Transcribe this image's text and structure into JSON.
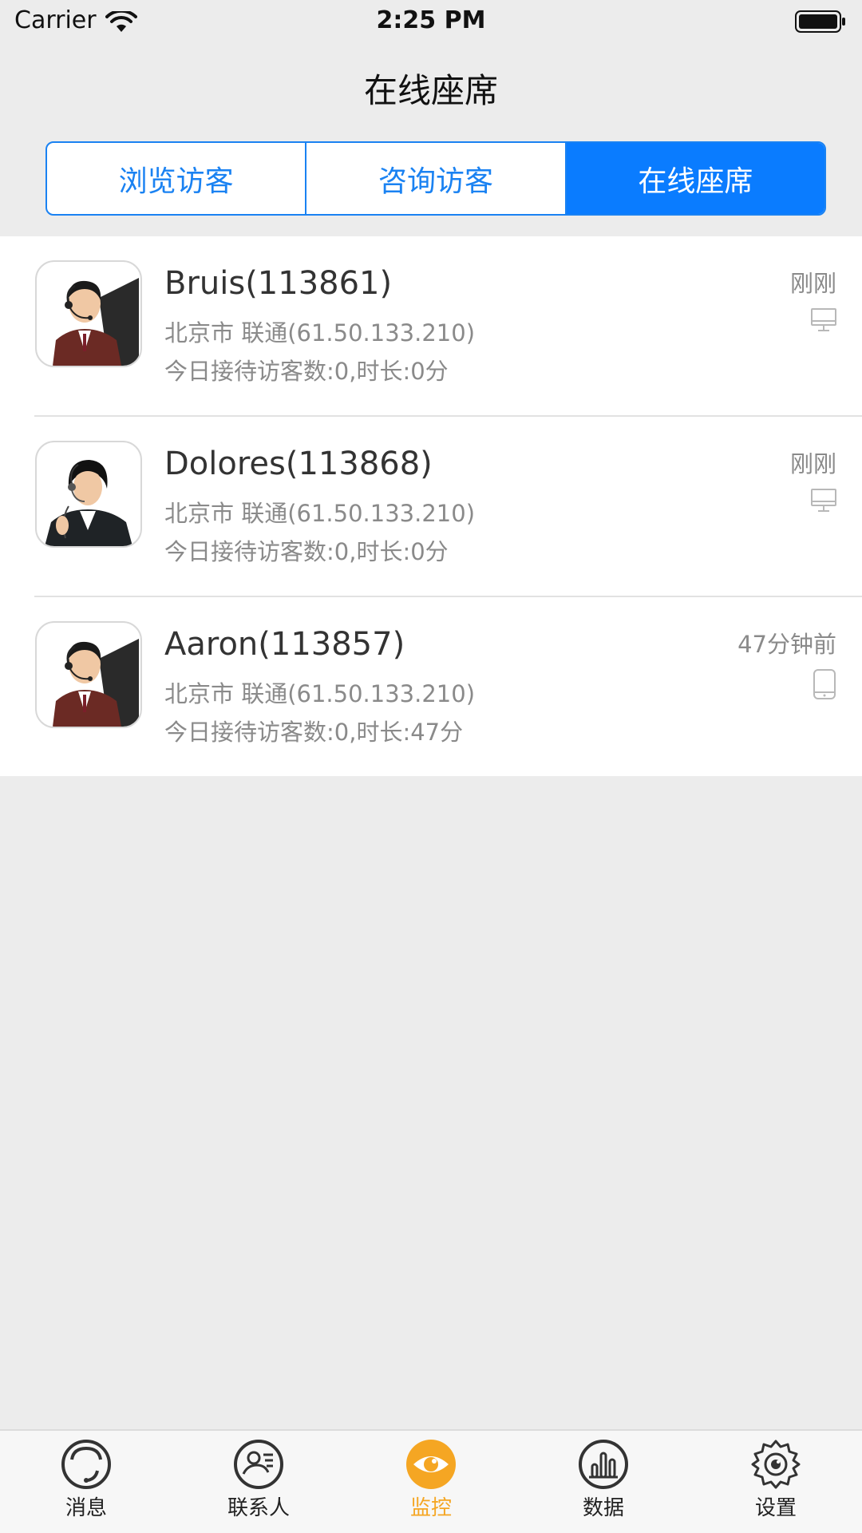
{
  "status_bar": {
    "carrier": "Carrier",
    "time": "2:25 PM"
  },
  "nav": {
    "title": "在线座席"
  },
  "segments": [
    {
      "label": "浏览访客",
      "active": false
    },
    {
      "label": "咨询访客",
      "active": false
    },
    {
      "label": "在线座席",
      "active": true
    }
  ],
  "agents": [
    {
      "name": "Bruis(113861)",
      "location": "北京市 联通(61.50.133.210)",
      "stats": "今日接待访客数:0,时长:0分",
      "time": "刚刚",
      "device_icon": "desktop-icon",
      "avatar": "male-agent"
    },
    {
      "name": "Dolores(113868)",
      "location": "北京市 联通(61.50.133.210)",
      "stats": "今日接待访客数:0,时长:0分",
      "time": "刚刚",
      "device_icon": "desktop-icon",
      "avatar": "female-agent"
    },
    {
      "name": "Aaron(113857)",
      "location": "北京市 联通(61.50.133.210)",
      "stats": "今日接待访客数:0,时长:47分",
      "time": "47分钟前",
      "device_icon": "mobile-icon",
      "avatar": "male-agent"
    }
  ],
  "tabs": [
    {
      "label": "消息",
      "icon": "message-icon",
      "active": false
    },
    {
      "label": "联系人",
      "icon": "contacts-icon",
      "active": false
    },
    {
      "label": "监控",
      "icon": "eye-icon",
      "active": true
    },
    {
      "label": "数据",
      "icon": "chart-icon",
      "active": false
    },
    {
      "label": "设置",
      "icon": "gear-icon",
      "active": false
    }
  ],
  "colors": {
    "accent": "#0a7cff",
    "active_tab": "#f5a623",
    "background": "#ececec"
  }
}
